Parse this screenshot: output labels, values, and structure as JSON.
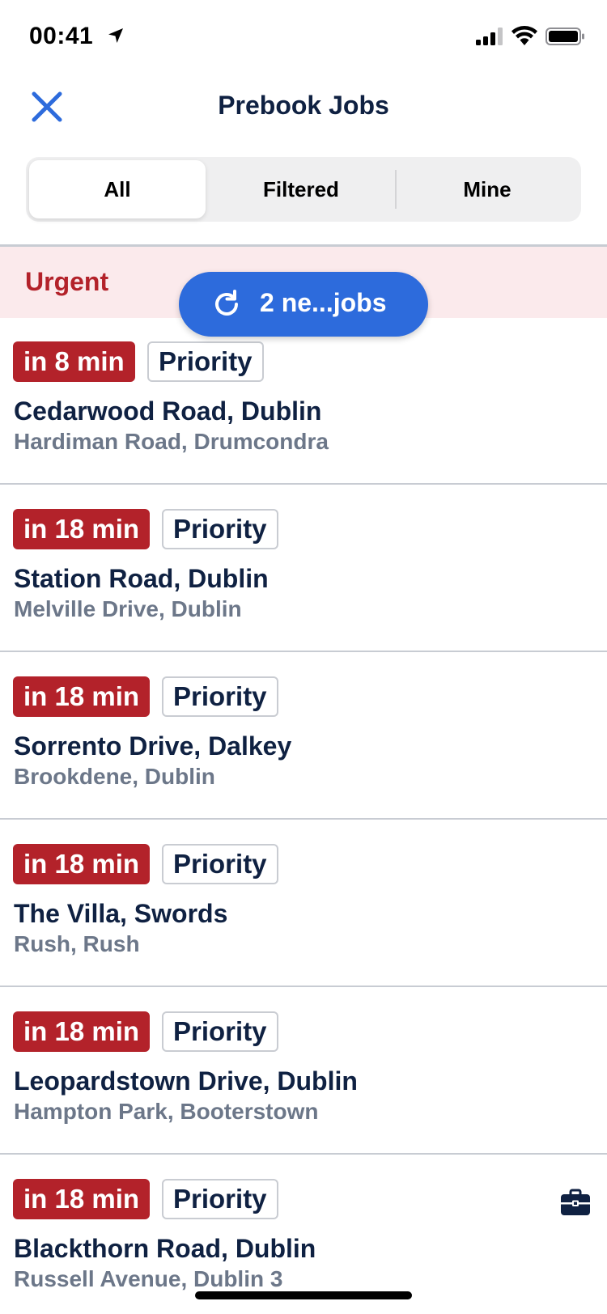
{
  "status_bar": {
    "time": "00:41"
  },
  "header": {
    "title": "Prebook Jobs"
  },
  "tabs": [
    {
      "label": "All",
      "active": true
    },
    {
      "label": "Filtered",
      "active": false
    },
    {
      "label": "Mine",
      "active": false
    }
  ],
  "section": {
    "label": "Urgent"
  },
  "new_jobs": {
    "label": "2 ne...jobs"
  },
  "jobs": [
    {
      "time": "in 8 min",
      "badge": "Priority",
      "pickup": "Cedarwood Road, Dublin",
      "dropoff": "Hardiman Road, Drumcondra"
    },
    {
      "time": "in 18 min",
      "badge": "Priority",
      "pickup": "Station Road, Dublin",
      "dropoff": "Melville Drive, Dublin"
    },
    {
      "time": "in 18 min",
      "badge": "Priority",
      "pickup": "Sorrento Drive, Dalkey",
      "dropoff": "Brookdene, Dublin"
    },
    {
      "time": "in 18 min",
      "badge": "Priority",
      "pickup": "The Villa, Swords",
      "dropoff": "Rush, Rush"
    },
    {
      "time": "in 18 min",
      "badge": "Priority",
      "pickup": "Leopardstown Drive, Dublin",
      "dropoff": "Hampton Park, Booterstown"
    },
    {
      "time": "in 18 min",
      "badge": "Priority",
      "pickup": "Blackthorn Road, Dublin",
      "dropoff": "Russell Avenue, Dublin 3",
      "icon": "briefcase-icon"
    }
  ],
  "colors": {
    "accent": "#2d6bdc",
    "urgent": "#b3222a",
    "urgent_band": "#fbeaec",
    "text_primary": "#0f2142",
    "text_secondary": "#6c7789"
  }
}
